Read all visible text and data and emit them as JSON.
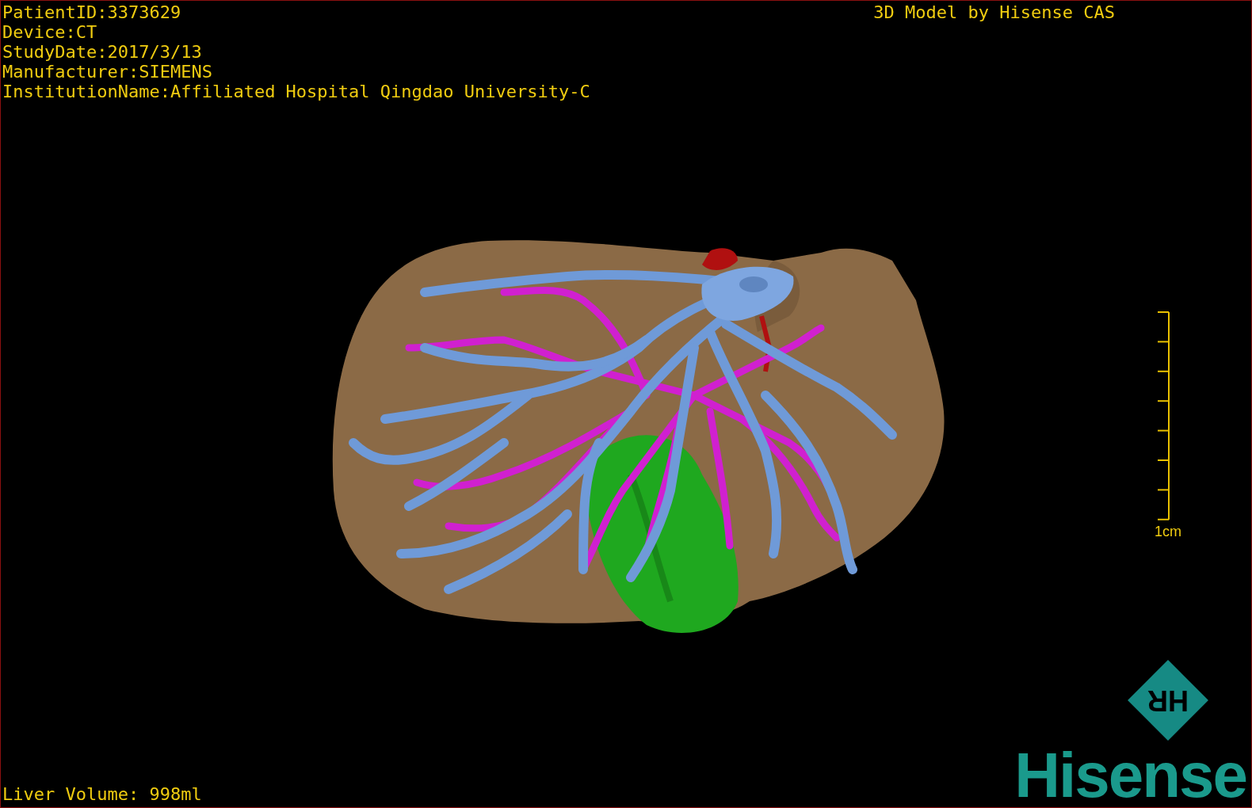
{
  "info_lines": [
    "PatientID:3373629",
    "Device:CT",
    "StudyDate:2017/3/13",
    "Manufacturer:SIEMENS",
    "InstitutionName:Affiliated Hospital Qingdao University-C"
  ],
  "title": "3D Model by Hisense CAS",
  "scale_bar": {
    "label": "1cm"
  },
  "footer": {
    "liver_volume": "Liver Volume: 998ml"
  },
  "logo": {
    "mark": "HR",
    "wordmark": "Hisense"
  }
}
